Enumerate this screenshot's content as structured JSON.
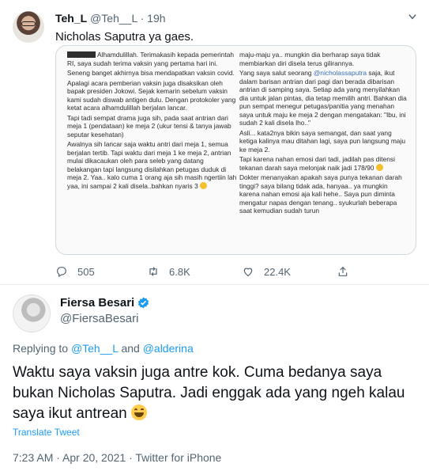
{
  "tweet1": {
    "name": "Teh_L",
    "handle": "@Teh__L",
    "sep": " · ",
    "time": "19h",
    "text": "Nicholas Saputra ya gaes.",
    "media_left": [
      "Alhamdulillah. Terimakasih kepada pemerintah RI, saya sudah terima vaksin yang pertama hari ini.",
      "Seneng banget akhirnya bisa mendapatkan vaksin covid.",
      "Apalagi acara pemberian vaksin juga disaksikan oleh bapak presiden Jokowi. Sejak kemarin sebelum vaksin kami sudah diswab antigen dulu. Dengan protokoler yang ketat acara alhamdulillah berjalan lancar.",
      "Tapi tadi sempat drama juga sih, pada saat antrian dari meja 1 (pendataan) ke meja 2 (ukur tensi & tanya jawab seputar kesehatan)",
      "Awalnya sih lancar saja waktu antri dari meja 1, semua berjalan tertib. Tapi waktu dari meja 1 ke meja 2, antrian mulai dikacaukan oleh para seleb yang datang belakangan tapi langsung disilahkan petugas duduk di meja 2. Yaa.. kalo cuma 1 orang aja sih masih ngertiin lah yaa, ini sampai 2 kali disela..bahkan nyaris 3"
    ],
    "media_right": [
      "maju-maju ya.. mungkin dia berharap saya tidak membiarkan diri disela terus gilirannya.",
      "Yang saya salut seorang",
      "@nicholassaputra",
      "saja, ikut dalam barisan antrian dari pagi dan berada dibarisan antrian di samping saya. Setiap ada yang menyilahkan dia untuk jalan pintas, dia tetap memilih antri. Bahkan dia pun sempat menegur petugas/panitia yang menahan saya untuk maju ke meja 2 dengan mengatakan: \"Ibu, ini sudah 2 kali disela lho..\"",
      "Asli... kata2nya bikin saya semangat, dan saat yang ketiga kalinya mau ditahan lagi, saya pun langsung maju ke meja 2.",
      "Tapi karena nahan emosi dari tadi, jadilah pas ditensi tekanan darah saya melonjak naik jadi 178/90",
      "Dokter menanyakan apakah saya punya tekanan darah tinggi? saya bilang tidak ada, hanyaa.. ya mungkin karena nahan emosi aja kali hehe.. Saya pun diminta mengatur napas dengan tenang.. syukurlah beberapa saat kemudian sudah turun"
    ],
    "actions": {
      "replies": "505",
      "retweets": "6.8K",
      "likes": "22.4K"
    }
  },
  "tweet2": {
    "name": "Fiersa Besari",
    "handle": "@FiersaBesari",
    "replying_prefix": "Replying to",
    "reply_to_1": "@Teh__L",
    "and": "and",
    "reply_to_2": "@alderina",
    "text": "Waktu saya vaksin juga antre kok. Cuma bedanya saya bukan Nicholas Saputra. Jadi enggak ada yang ngeh kalau saya ikut antrean",
    "translate": "Translate Tweet",
    "footer": "7:23 AM · Apr 20, 2021 · Twitter for iPhone"
  },
  "colors": {
    "link": "#1d9bf0",
    "verified": "#1d9bf0",
    "muted": "#536471"
  },
  "icons": [
    "reply-icon",
    "retweet-icon",
    "like-icon",
    "share-icon",
    "verified-icon",
    "more-icon"
  ]
}
